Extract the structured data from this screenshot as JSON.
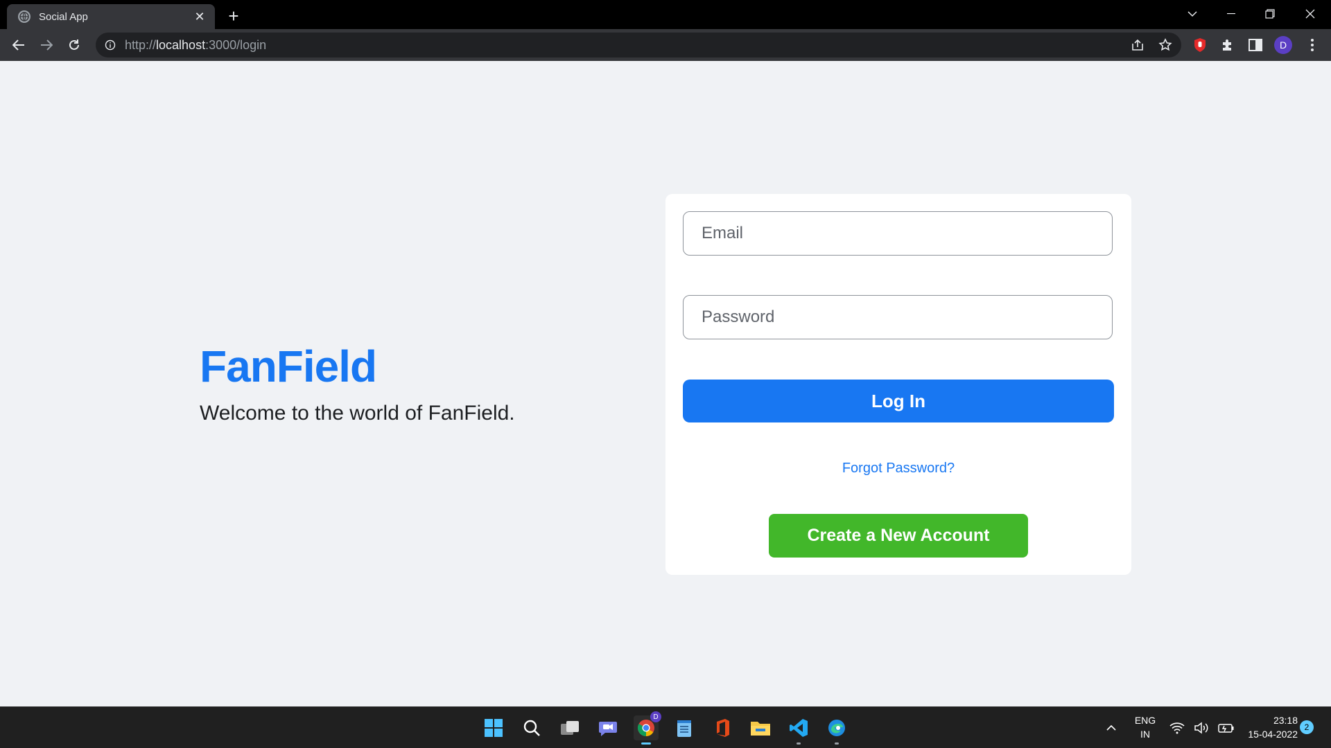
{
  "browser": {
    "tab_title": "Social App",
    "tab_close": "✕",
    "new_tab": "+",
    "url_scheme": "http://",
    "url_host": "localhost",
    "url_path": ":3000/login",
    "profile_initial": "D"
  },
  "page": {
    "brand": "FanField",
    "tagline": "Welcome to the world of FanField.",
    "email_placeholder": "Email",
    "password_placeholder": "Password",
    "login_label": "Log In",
    "forgot_label": "Forgot Password?",
    "create_label": "Create a New Account"
  },
  "colors": {
    "brand": "#1877f2",
    "login_button": "#1877f2",
    "create_button": "#42b72a",
    "page_background": "#f0f2f5"
  },
  "taskbar": {
    "apps": [
      "windows-start-icon",
      "search-icon",
      "task-view-icon",
      "teams-chat-icon",
      "chrome-icon",
      "notepad-icon",
      "office-icon",
      "file-explorer-icon",
      "vscode-icon",
      "edge-icon"
    ],
    "lang_line1": "ENG",
    "lang_line2": "IN",
    "time": "23:18",
    "date": "15-04-2022",
    "notification_count": "2",
    "chrome_badge": "D"
  }
}
